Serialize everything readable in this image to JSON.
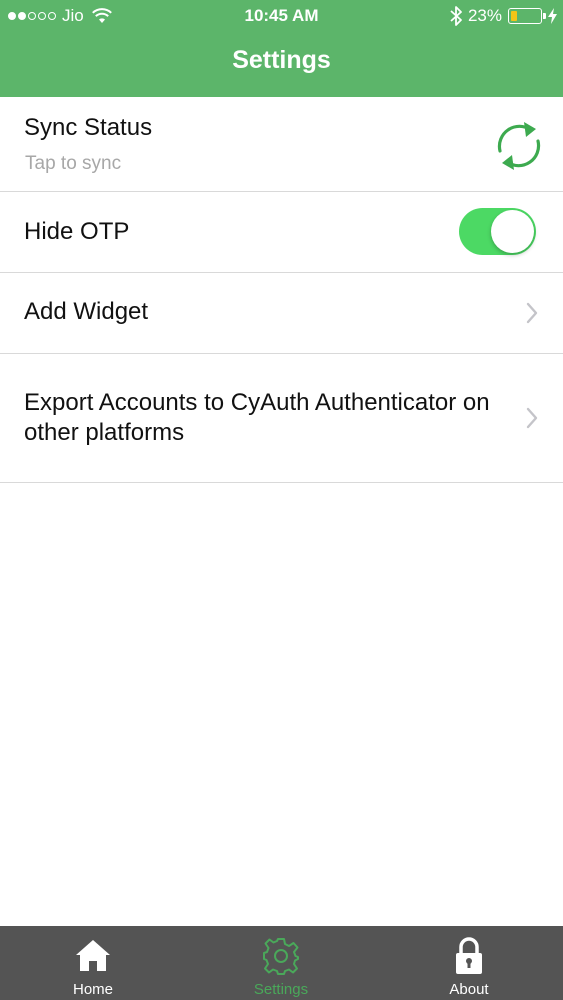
{
  "status_bar": {
    "carrier": "Jio",
    "time": "10:45 AM",
    "battery_percent": "23%",
    "battery_level": 0.23,
    "signal_bars_filled": 2,
    "signal_bars_total": 5
  },
  "header": {
    "title": "Settings",
    "color": "#5cb56a"
  },
  "settings": {
    "sync": {
      "label": "Sync Status",
      "sublabel": "Tap to sync",
      "icon": "sync-icon"
    },
    "hide_otp": {
      "label": "Hide OTP",
      "enabled": true
    },
    "add_widget": {
      "label": "Add Widget",
      "icon": "chevron-right-icon"
    },
    "export": {
      "label": "Export Accounts to CyAuth Authenticator on other platforms",
      "icon": "chevron-right-icon"
    }
  },
  "tabbar": {
    "tabs": [
      {
        "label": "Home",
        "icon": "home-icon",
        "active": false
      },
      {
        "label": "Settings",
        "icon": "gear-icon",
        "active": true
      },
      {
        "label": "About",
        "icon": "lock-icon",
        "active": false
      }
    ],
    "active_color": "#4aa85a"
  }
}
